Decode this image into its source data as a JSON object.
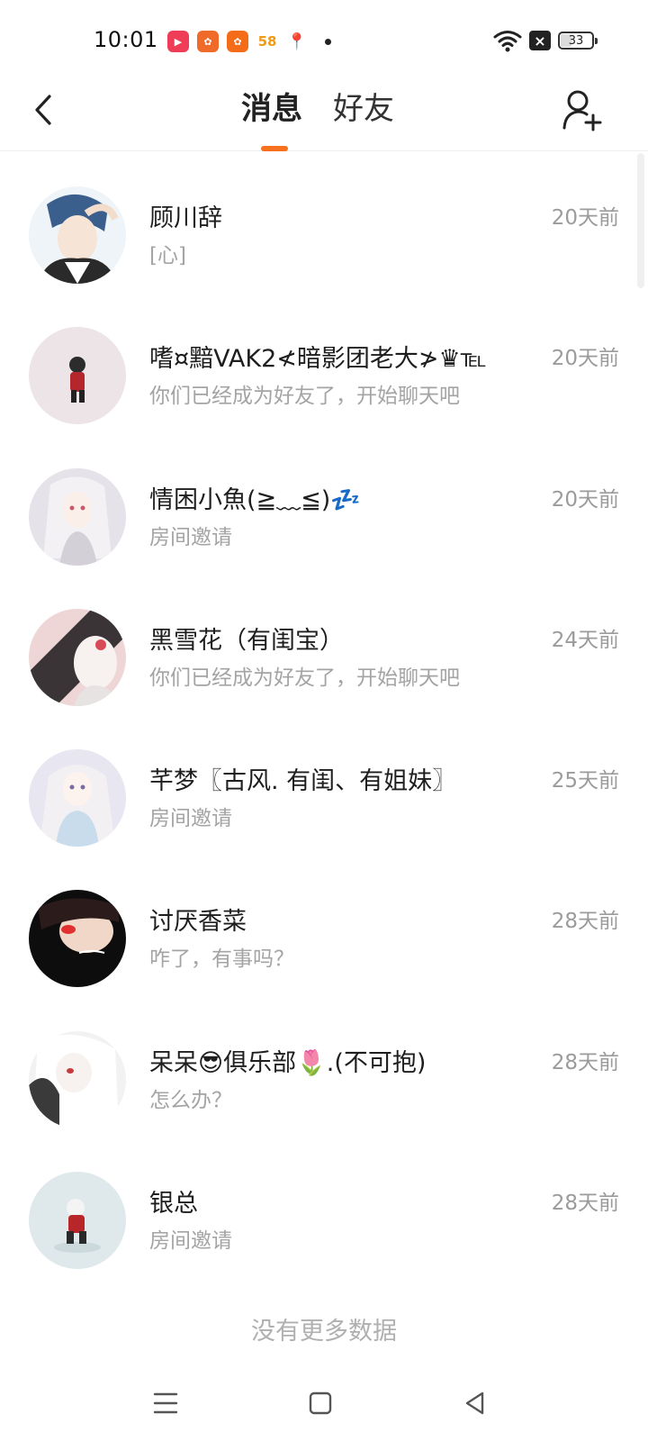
{
  "status_bar": {
    "time": "10:01",
    "apps": [
      {
        "icon": "video-app-icon",
        "glyph": "▶"
      },
      {
        "icon": "kuaishou-app-icon",
        "glyph": "✿"
      },
      {
        "icon": "kuaishou-lite-app-icon",
        "glyph": "✿"
      },
      {
        "icon": "58-app-icon",
        "glyph": "58"
      },
      {
        "icon": "map-pin-app-icon",
        "glyph": "📍"
      }
    ],
    "battery": "33",
    "battery_level": 0.33
  },
  "header": {
    "back_icon": "chevron-left-icon",
    "tabs": [
      {
        "label": "消息",
        "active": true
      },
      {
        "label": "好友",
        "active": false
      }
    ],
    "add_friend_icon": "add-user-icon",
    "accent": "#f7711e"
  },
  "messages": [
    {
      "name": "顾川辞",
      "preview": "[心]",
      "time": "20天前"
    },
    {
      "name": "嗜¤黯VAK2≮暗影团老大≯♛℡",
      "preview": "你们已经成为好友了，开始聊天吧",
      "time": "20天前"
    },
    {
      "name": "情困小魚(≧﹏≦)💤",
      "preview": "房间邀请",
      "time": "20天前"
    },
    {
      "name": "黑雪花（有闺宝）",
      "preview": "你们已经成为好友了，开始聊天吧",
      "time": "24天前"
    },
    {
      "name": "芊梦〖古风. 有闺、有姐妹〗",
      "preview": "房间邀请",
      "time": "25天前"
    },
    {
      "name": "讨厌香菜",
      "preview": "咋了，有事吗？",
      "time": "28天前"
    },
    {
      "name": "呆呆😎俱乐部🌷.(不可抱)",
      "preview": "怎么办？",
      "time": "28天前"
    },
    {
      "name": "银总",
      "preview": "房间邀请",
      "time": "28天前"
    }
  ],
  "footer": {
    "no_more": "没有更多数据"
  },
  "nav_bar": {
    "menu_icon": "menu-icon",
    "home_icon": "home-square-icon",
    "back_icon": "back-triangle-icon"
  }
}
